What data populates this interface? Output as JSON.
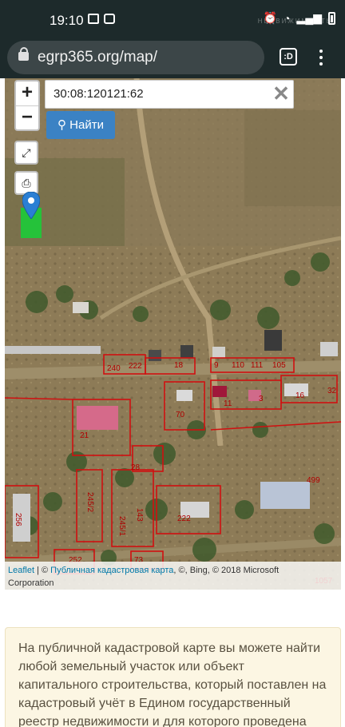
{
  "status_bar": {
    "time": "19:10",
    "watermark_main": "",
    "watermark_sub": "НЕДВИЖИМОСТЬ"
  },
  "browser": {
    "url": "egrp365.org/map/",
    "tabs_label": ":D"
  },
  "map": {
    "zoom_in": "+",
    "zoom_out": "−",
    "search_value": "30:08:120121:62",
    "search_button": "Найти",
    "clear_icon": "✕",
    "fullscreen_icon": "expand-icon",
    "print_icon": "printer-icon",
    "parcel_labels": [
      "240",
      "222",
      "18",
      "9",
      "110",
      "111",
      "105",
      "11",
      "3",
      "16",
      "32",
      "70",
      "21",
      "28",
      "245/2",
      "245/1",
      "143",
      "222",
      "256",
      "252",
      "73",
      "499",
      "1057"
    ],
    "attribution": {
      "leaflet": "Leaflet",
      "sep": " | © ",
      "pkk": "Публичная кадастровая карта",
      "rest": ", ©, Bing, © 2018 Microsoft",
      "line2": "Corporation"
    }
  },
  "info_text": "На публичной кадастровой карте вы можете найти любой земельный участок или объект капитального строительства, который поставлен на кадастровый учёт в Едином государственный реестр недвижимости и для которого проведена"
}
